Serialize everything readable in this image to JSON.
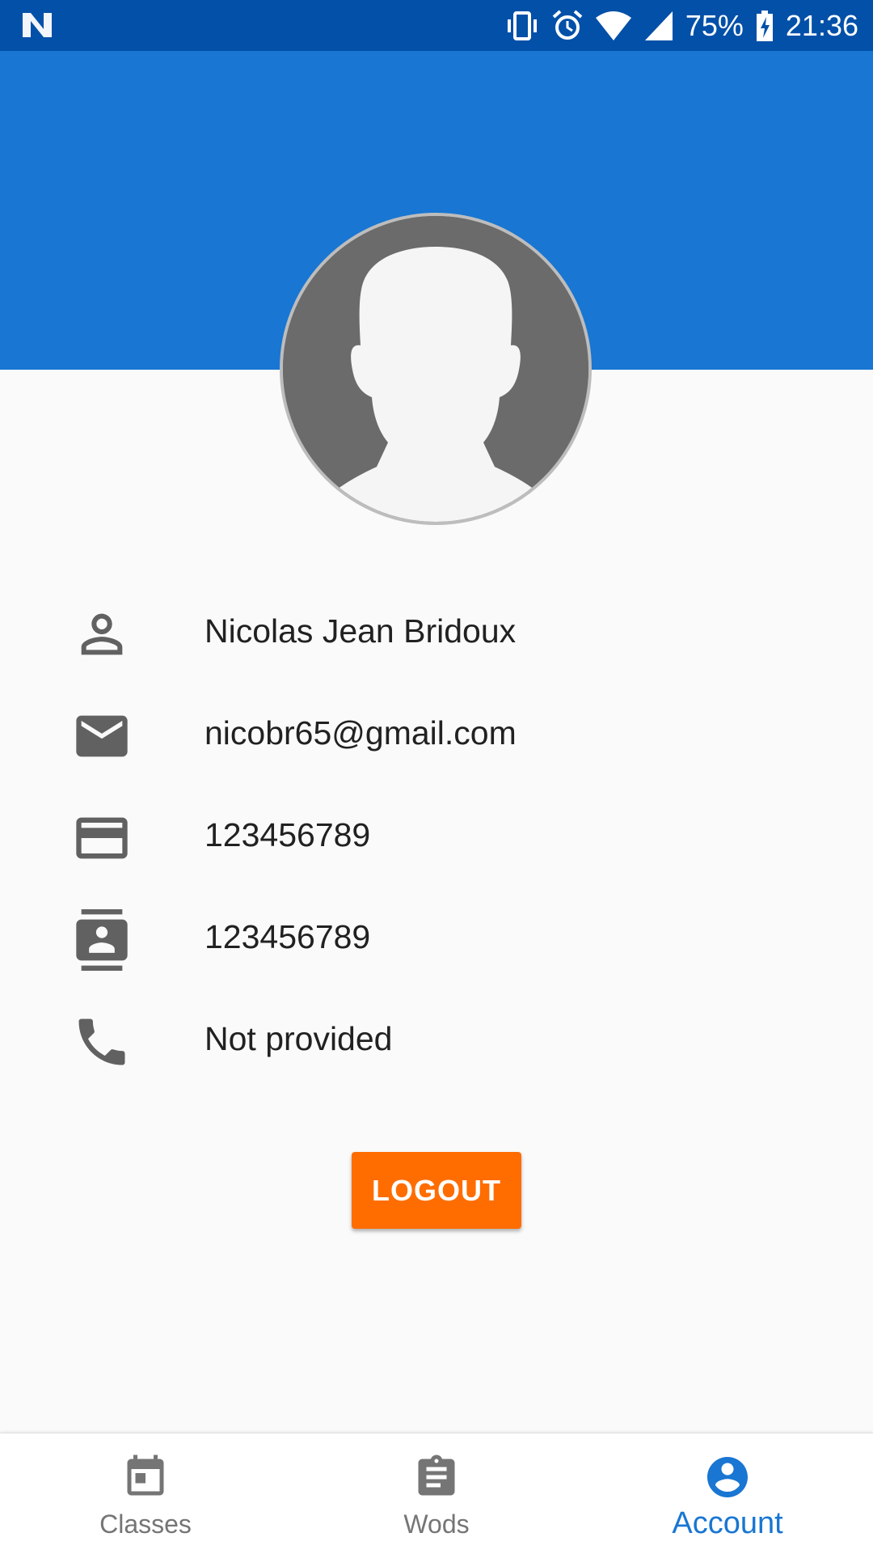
{
  "status_bar": {
    "battery": "75%",
    "time": "21:36",
    "icons": [
      "n-logo-icon",
      "vibrate-icon",
      "alarm-icon",
      "wifi-icon",
      "signal-icon",
      "battery-charging-icon"
    ]
  },
  "profile": {
    "avatar_icon": "default-avatar-icon",
    "name": "Nicolas Jean Bridoux",
    "email": "nicobr65@gmail.com",
    "card_number": "123456789",
    "member_id": "123456789",
    "phone": "Not provided"
  },
  "actions": {
    "logout_label": "LOGOUT"
  },
  "bottom_nav": {
    "items": [
      {
        "label": "Classes",
        "icon": "calendar-icon",
        "active": false
      },
      {
        "label": "Wods",
        "icon": "clipboard-icon",
        "active": false
      },
      {
        "label": "Account",
        "icon": "account-circle-icon",
        "active": true
      }
    ]
  },
  "colors": {
    "status_bar": "#0250a8",
    "header": "#1976d2",
    "accent": "#ff6d00",
    "active_nav": "#1976d2",
    "icon_gray": "#616161"
  }
}
